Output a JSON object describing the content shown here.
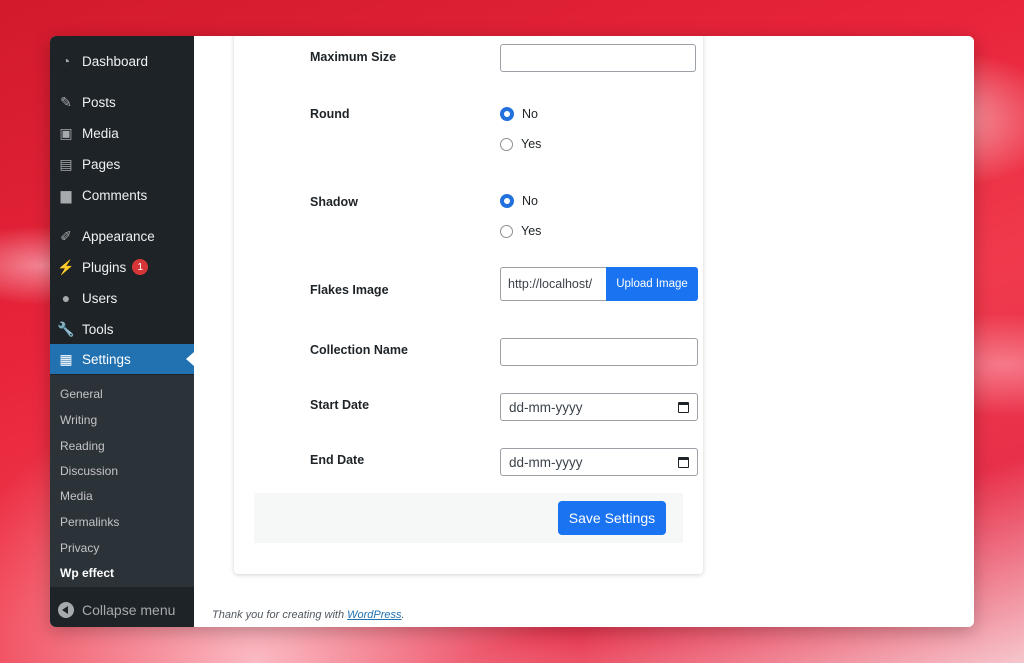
{
  "sidebar": {
    "items": [
      {
        "label": "Dashboard",
        "icon": "dashboard-icon"
      },
      {
        "label": "Posts",
        "icon": "pin-icon"
      },
      {
        "label": "Media",
        "icon": "media-icon"
      },
      {
        "label": "Pages",
        "icon": "pages-icon"
      },
      {
        "label": "Comments",
        "icon": "comment-icon"
      },
      {
        "label": "Appearance",
        "icon": "brush-icon"
      },
      {
        "label": "Plugins",
        "icon": "plugin-icon",
        "badge": "1"
      },
      {
        "label": "Users",
        "icon": "user-icon"
      },
      {
        "label": "Tools",
        "icon": "wrench-icon"
      },
      {
        "label": "Settings",
        "icon": "settings-icon",
        "active": true
      }
    ],
    "submenu": [
      "General",
      "Writing",
      "Reading",
      "Discussion",
      "Media",
      "Permalinks",
      "Privacy",
      "Wp effect"
    ],
    "collapse_label": "Collapse menu"
  },
  "form": {
    "max_size_label": "Maximum Size",
    "max_size_value": "",
    "round_label": "Round",
    "round_options": [
      "No",
      "Yes"
    ],
    "round_selected": "No",
    "shadow_label": "Shadow",
    "shadow_options": [
      "No",
      "Yes"
    ],
    "shadow_selected": "No",
    "flakes_label": "Flakes Image",
    "flakes_value": "http://localhost/",
    "upload_label": "Upload Image",
    "collection_label": "Collection Name",
    "collection_value": "",
    "start_label": "Start Date",
    "start_value": "dd-mm-yyyy",
    "end_label": "End Date",
    "end_value": "dd-mm-yyyy",
    "save_label": "Save Settings"
  },
  "footer": {
    "text": "Thank you for creating with",
    "link": "WordPress",
    "end": "."
  },
  "colors": {
    "sidebar_bg": "#1d2327",
    "active_bg": "#2271b1",
    "button_bg": "#1a73f0",
    "badge": "#d63638"
  }
}
